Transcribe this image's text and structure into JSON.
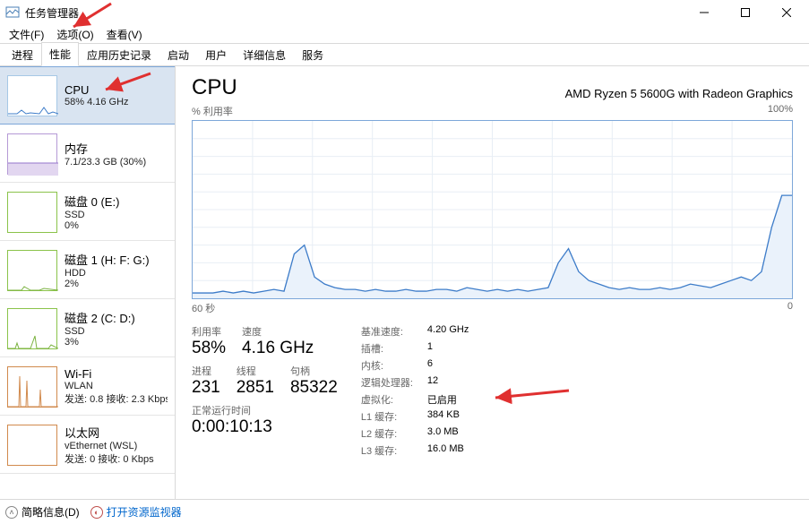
{
  "window": {
    "title": "任务管理器"
  },
  "menu": {
    "file": "文件(F)",
    "options": "选项(O)",
    "view": "查看(V)"
  },
  "tabs": {
    "processes": "进程",
    "performance": "性能",
    "app_history": "应用历史记录",
    "startup": "启动",
    "users": "用户",
    "details": "详细信息",
    "services": "服务"
  },
  "sidebar": {
    "cpu": {
      "title": "CPU",
      "sub": "58% 4.16 GHz"
    },
    "mem": {
      "title": "内存",
      "sub": "7.1/23.3 GB (30%)"
    },
    "disk0": {
      "title": "磁盘 0 (E:)",
      "sub": "SSD",
      "sub2": "0%"
    },
    "disk1": {
      "title": "磁盘 1 (H: F: G:)",
      "sub": "HDD",
      "sub2": "2%"
    },
    "disk2": {
      "title": "磁盘 2 (C: D:)",
      "sub": "SSD",
      "sub2": "3%"
    },
    "wifi": {
      "title": "Wi-Fi",
      "sub": "WLAN",
      "sub2": "发送: 0.8 接收: 2.3 Kbps"
    },
    "eth": {
      "title": "以太网",
      "sub": "vEthernet (WSL)",
      "sub2": "发送: 0 接收: 0 Kbps"
    }
  },
  "main": {
    "title": "CPU",
    "model": "AMD Ryzen 5 5600G with Radeon Graphics",
    "chart_top_left": "% 利用率",
    "chart_top_right": "100%",
    "chart_bottom_left": "60 秒",
    "chart_bottom_right": "0",
    "util_lbl": "利用率",
    "util_val": "58%",
    "speed_lbl": "速度",
    "speed_val": "4.16 GHz",
    "proc_lbl": "进程",
    "proc_val": "231",
    "thread_lbl": "线程",
    "thread_val": "2851",
    "handle_lbl": "句柄",
    "handle_val": "85322",
    "uptime_lbl": "正常运行时间",
    "uptime_val": "0:00:10:13",
    "base_lbl": "基准速度:",
    "base_val": "4.20 GHz",
    "socket_lbl": "插槽:",
    "socket_val": "1",
    "core_lbl": "内核:",
    "core_val": "6",
    "lp_lbl": "逻辑处理器:",
    "lp_val": "12",
    "virt_lbl": "虚拟化:",
    "virt_val": "已启用",
    "l1_lbl": "L1 缓存:",
    "l1_val": "384 KB",
    "l2_lbl": "L2 缓存:",
    "l2_val": "3.0 MB",
    "l3_lbl": "L3 缓存:",
    "l3_val": "16.0 MB"
  },
  "footer": {
    "brief": "简略信息(D)",
    "resmon": "打开资源监视器"
  },
  "chart_data": {
    "type": "line",
    "title": "% 利用率",
    "ylabel": "",
    "xlabel": "",
    "ylim": [
      0,
      100
    ],
    "xrange_seconds": 60,
    "values": [
      3,
      3,
      3,
      4,
      3,
      4,
      3,
      4,
      5,
      4,
      25,
      30,
      12,
      8,
      6,
      5,
      5,
      4,
      5,
      4,
      4,
      5,
      4,
      4,
      5,
      5,
      4,
      6,
      5,
      4,
      5,
      4,
      5,
      4,
      5,
      6,
      20,
      28,
      15,
      10,
      8,
      6,
      5,
      6,
      5,
      5,
      6,
      5,
      6,
      8,
      7,
      6,
      8,
      10,
      12,
      10,
      15,
      40,
      58,
      58
    ]
  }
}
